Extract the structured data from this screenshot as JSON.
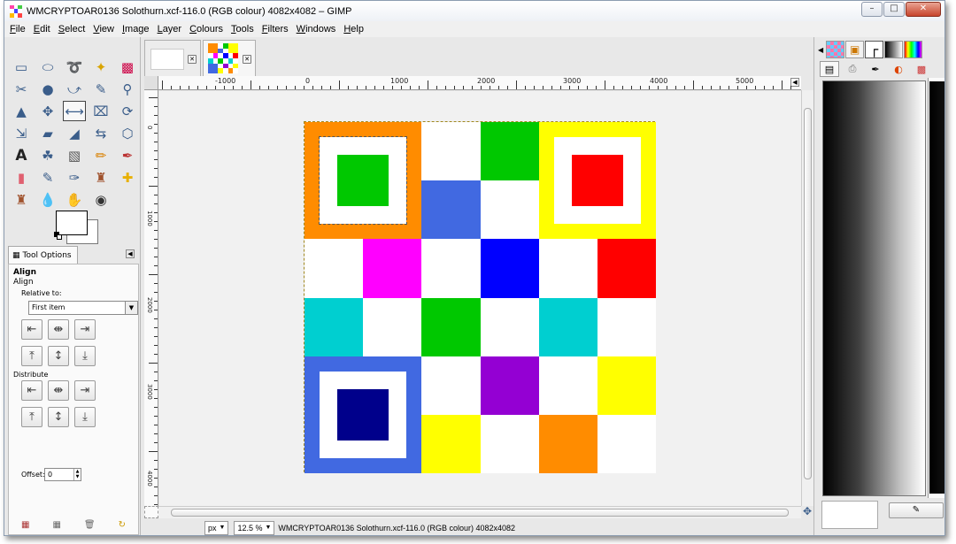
{
  "window": {
    "title": "WMCRYPTOAR0136 Solothurn.xcf-116.0 (RGB colour) 4082x4082 – GIMP",
    "controls": {
      "minimize": "–",
      "maximize": "□",
      "close": "✕"
    }
  },
  "menu": [
    "File",
    "Edit",
    "Select",
    "View",
    "Image",
    "Layer",
    "Colours",
    "Tools",
    "Filters",
    "Windows",
    "Help"
  ],
  "tool_options": {
    "tab_label": "Tool Options",
    "title": "Align",
    "subtitle": "Align",
    "relative_label": "Relative to:",
    "relative_value": "First item",
    "distribute_label": "Distribute",
    "offset_label": "Offset:",
    "offset_value": "0"
  },
  "ruler": {
    "h_labels": [
      "-1000",
      "0",
      "1000",
      "2000",
      "3000",
      "4000",
      "5000"
    ],
    "v_labels": [
      "0",
      "1000",
      "2000",
      "3000",
      "4000"
    ]
  },
  "image": {
    "grid": [
      [
        "#ff8c00",
        "#ff8c00",
        "#ffffff",
        "#00c800",
        "#ffff00",
        "#ffff00"
      ],
      [
        "#ff8c00",
        "#ff8c00",
        "#4169e1",
        "#ffffff",
        "#ffff00",
        "#ffff00"
      ],
      [
        "#ffffff",
        "#ff00ff",
        "#ffffff",
        "#0000ff",
        "#ffffff",
        "#ff0000"
      ],
      [
        "#00cfd0",
        "#ffffff",
        "#00c800",
        "#ffffff",
        "#00cfd0",
        "#ffffff"
      ],
      [
        "#4169e1",
        "#4169e1",
        "#ffffff",
        "#9400d3",
        "#ffffff",
        "#ffff00"
      ],
      [
        "#4169e1",
        "#4169e1",
        "#ffff00",
        "#ffffff",
        "#ff8c00",
        "#ffffff"
      ]
    ],
    "squares": [
      {
        "outer": "#ff8c00",
        "inner": "#00c800"
      },
      {
        "outer": "#ffff00",
        "inner": "#ff0000"
      },
      {
        "outer": "#4169e1",
        "inner": "#00008b"
      }
    ]
  },
  "status": {
    "unit": "px",
    "zoom": "12.5 %",
    "info": "WMCRYPTOAR0136 Solothurn.xcf-116.0 (RGB colour) 4082x4082"
  },
  "colors": {
    "accent": "#3a5d8a",
    "fg": "#000000",
    "bg": "#ffffff"
  }
}
